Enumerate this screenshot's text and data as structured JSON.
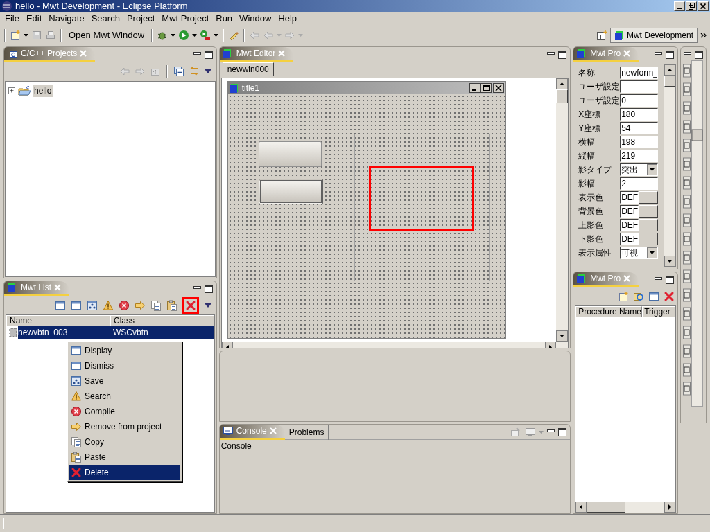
{
  "window": {
    "title": "hello - Mwt Development - Eclipse Platform"
  },
  "menu": [
    "File",
    "Edit",
    "Navigate",
    "Search",
    "Project",
    "Mwt Project",
    "Run",
    "Window",
    "Help"
  ],
  "toolbar": {
    "open_button": "Open Mwt Window"
  },
  "perspective": {
    "label": "Mwt Development"
  },
  "projects_view": {
    "title": "C/C++ Projects",
    "tree": [
      {
        "label": "hello",
        "expanded": false
      }
    ]
  },
  "list_view": {
    "title": "Mwt List",
    "columns": [
      "Name",
      "Class"
    ],
    "rows": [
      {
        "name": "newvbtn_003",
        "class": "WSCvbtn",
        "selected": true
      }
    ]
  },
  "context_menu": {
    "items": [
      {
        "label": "Display",
        "selected": false
      },
      {
        "label": "Dismiss",
        "selected": false
      },
      {
        "label": "Save",
        "selected": false
      },
      {
        "label": "Search",
        "selected": false
      },
      {
        "label": "Compile",
        "selected": false
      },
      {
        "label": "Remove from project",
        "selected": false
      },
      {
        "label": "Copy",
        "selected": false
      },
      {
        "label": "Paste",
        "selected": false
      },
      {
        "label": "Delete",
        "selected": true
      }
    ]
  },
  "editor": {
    "title": "Mwt Editor",
    "tab": "newwin000",
    "form_title": "title1"
  },
  "properties": {
    "title": "Mwt Pro",
    "rows": [
      {
        "kind": "text",
        "label": "名称",
        "value": "newform_"
      },
      {
        "kind": "text",
        "label": "ユーザ設定"
      },
      {
        "kind": "text",
        "label": "ユーザ設定",
        "value": "0"
      },
      {
        "kind": "text",
        "label": "X座標",
        "value": "180"
      },
      {
        "kind": "text",
        "label": "Y座標",
        "value": "54"
      },
      {
        "kind": "text",
        "label": "横幅",
        "value": "198"
      },
      {
        "kind": "text",
        "label": "縦幅",
        "value": "219"
      },
      {
        "kind": "select",
        "label": "影タイプ",
        "value": "突出"
      },
      {
        "kind": "text",
        "label": "影幅",
        "value": "2"
      },
      {
        "kind": "color",
        "label": "表示色",
        "value": "DEF"
      },
      {
        "kind": "color",
        "label": "背景色",
        "value": "DEF"
      },
      {
        "kind": "color",
        "label": "上影色",
        "value": "DEF"
      },
      {
        "kind": "color",
        "label": "下影色",
        "value": "DEF"
      },
      {
        "kind": "select",
        "label": "表示属性",
        "value": "可視"
      }
    ]
  },
  "procedures": {
    "title": "Mwt Pro",
    "columns": [
      "Procedure Name",
      "Trigger"
    ]
  },
  "console": {
    "tabs": [
      {
        "label": "Console",
        "selected": true
      },
      {
        "label": "Problems",
        "selected": false
      }
    ],
    "text": "Console"
  }
}
